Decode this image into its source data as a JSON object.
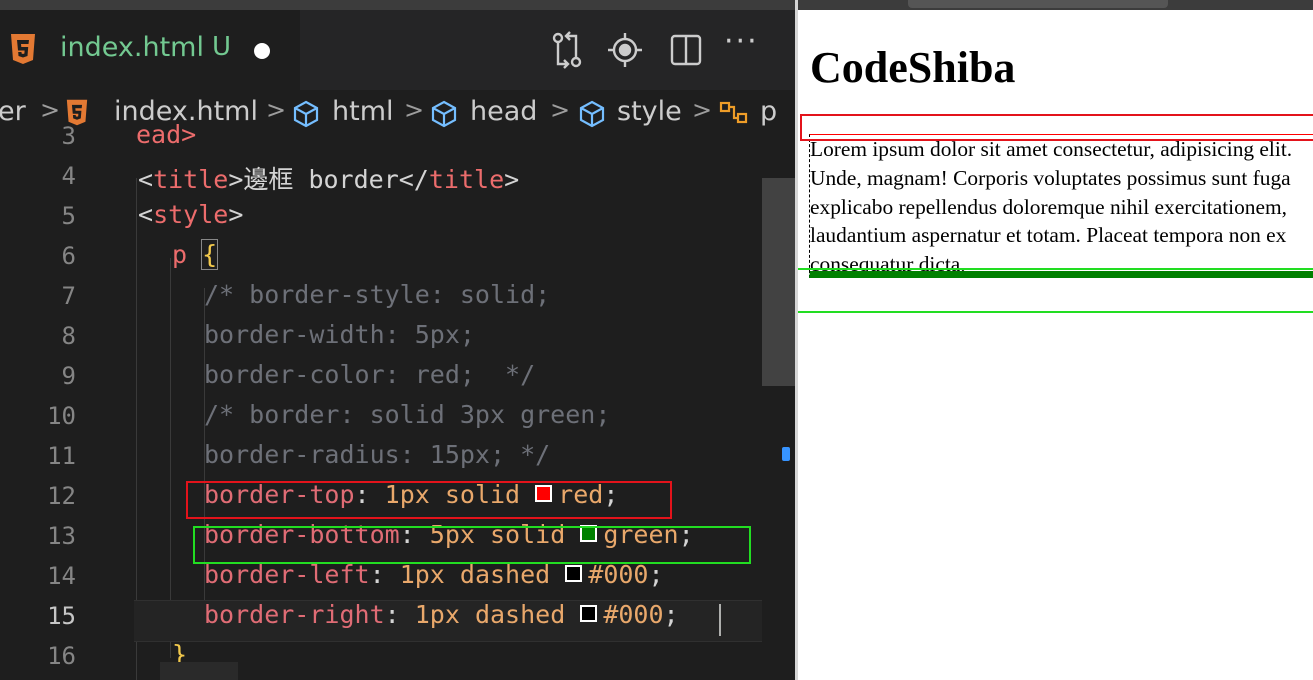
{
  "editor": {
    "tab": {
      "filename": "index.html",
      "status": "U"
    },
    "breadcrumb": [
      "er",
      "index.html",
      "html",
      "head",
      "style",
      "p"
    ],
    "lines": [
      {
        "num": "3",
        "text": "ead>"
      },
      {
        "num": "4",
        "open": "<",
        "tag": "title",
        "close": ">",
        "content": "邊框 border",
        "endopen": "</",
        "endtag": "title",
        "endclose": ">"
      },
      {
        "num": "5",
        "open": "<",
        "tag": "style",
        "close": ">"
      },
      {
        "num": "6",
        "selector": "p",
        "brace": "{"
      },
      {
        "num": "7",
        "comment": "/* border-style: solid;"
      },
      {
        "num": "8",
        "comment": "border-width: 5px;"
      },
      {
        "num": "9",
        "comment": "border-color: red;  */"
      },
      {
        "num": "10",
        "comment": "/* border: solid 3px green;"
      },
      {
        "num": "11",
        "comment": "border-radius: 15px; */"
      },
      {
        "num": "12",
        "prop": "border-top",
        "colon": ":",
        "value": "1px solid",
        "swatch": "#ff0000",
        "color_value": "red",
        "semi": ";"
      },
      {
        "num": "13",
        "prop": "border-bottom",
        "colon": ":",
        "value": "5px solid",
        "swatch": "#008000",
        "color_value": "green",
        "semi": ";"
      },
      {
        "num": "14",
        "prop": "border-left",
        "colon": ":",
        "value": "1px dashed",
        "swatch": "#000000",
        "color_value": "#000",
        "semi": ";"
      },
      {
        "num": "15",
        "prop": "border-right",
        "colon": ":",
        "value": "1px dashed",
        "swatch": "#000000",
        "color_value": "#000",
        "semi": ";"
      },
      {
        "num": "16",
        "brace": "}"
      }
    ]
  },
  "preview": {
    "heading": "CodeShiba",
    "paragraph": "Lorem ipsum dolor sit amet consectetur, adipisicing elit. Unde, magnam! Corporis voluptates possimus sunt fuga explicabo repellendus doloremque nihil exercitationem, laudantium aspernatur et totam. Placeat tempora non ex consequatur dicta."
  },
  "colors": {
    "annotation_red": "#e3131b",
    "annotation_green": "#22dd22",
    "untracked_green": "#73c991",
    "html5_orange": "#e37933"
  },
  "icons": [
    "html5-icon",
    "compare-changes-icon",
    "go-live-icon",
    "split-editor-icon",
    "more-actions-icon",
    "cube-icon",
    "css-rule-icon",
    "chevron-right-icon"
  ]
}
